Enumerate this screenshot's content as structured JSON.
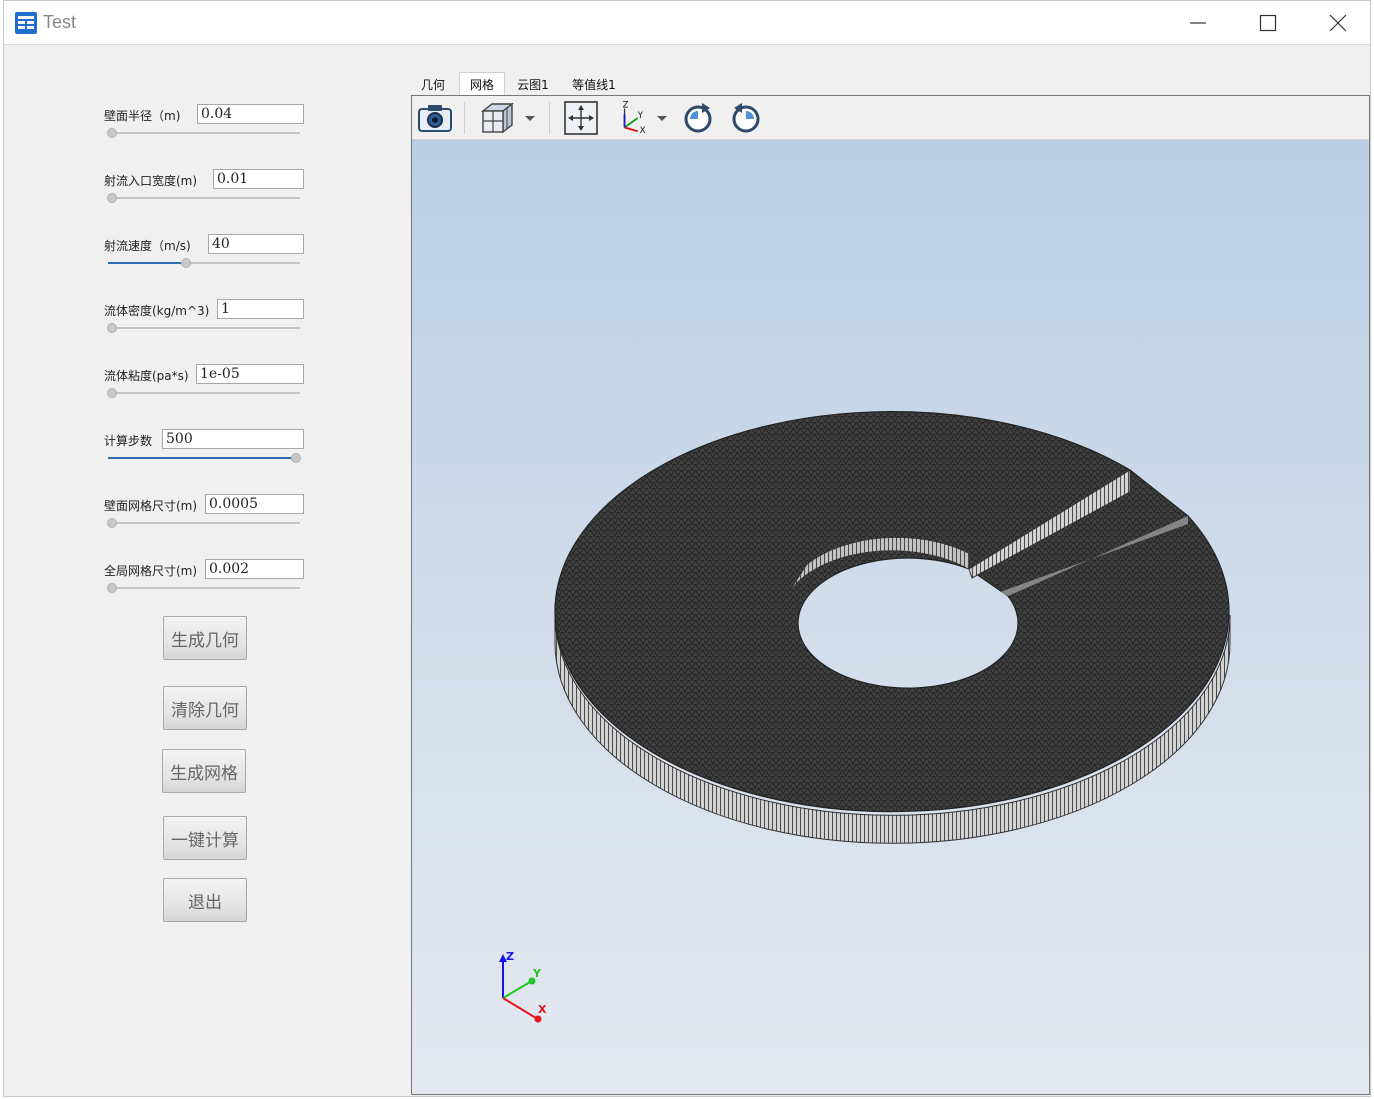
{
  "window": {
    "title": "Test"
  },
  "icons": {
    "app": "app-table-icon",
    "minimize": "minimize-icon",
    "maximize": "maximize-icon",
    "close": "close-icon"
  },
  "params": [
    {
      "label": "壁面半径（m)",
      "value": "0.04",
      "slider_fraction": 0.0
    },
    {
      "label": "射流入口宽度(m)",
      "value": "0.01",
      "slider_fraction": 0.0
    },
    {
      "label": "射流速度（m/s)",
      "value": "40",
      "slider_fraction": 0.4
    },
    {
      "label": "流体密度(kg/m^3)",
      "value": "1",
      "slider_fraction": 0.0
    },
    {
      "label": "流体粘度(pa*s)",
      "value": "1e-05",
      "slider_fraction": 0.0
    },
    {
      "label": "计算步数",
      "value": "500",
      "slider_fraction": 1.0
    },
    {
      "label": "壁面网格尺寸(m)",
      "value": "0.0005",
      "slider_fraction": 0.0
    },
    {
      "label": "全局网格尺寸(m)",
      "value": "0.002",
      "slider_fraction": 0.0
    }
  ],
  "buttons": {
    "generate_geometry": "生成几何",
    "clear_geometry": "清除几何",
    "generate_mesh": "生成网格",
    "compute": "一键计算",
    "exit": "退出"
  },
  "tabs": [
    {
      "label": "几何",
      "active": false
    },
    {
      "label": "网格",
      "active": true
    },
    {
      "label": "云图1",
      "active": false
    },
    {
      "label": "等值线1",
      "active": false
    }
  ],
  "toolbar": {
    "tools": [
      "camera-icon",
      "cube-view-icon",
      "fit-view-icon",
      "axes-orientation-icon",
      "rotate-clockwise-icon",
      "rotate-counterclockwise-icon"
    ]
  },
  "triad": {
    "x": "X",
    "y": "Y",
    "z": "Z"
  },
  "colors": {
    "viewport_top": "#bacfe5",
    "viewport_bottom": "#e4e8ef",
    "mesh_top": "#3a3a3a",
    "mesh_side": "#cfcfcf",
    "axis_x": "#e8141c",
    "axis_y": "#1ec81e",
    "axis_z": "#1414e6",
    "slider_fill": "#2f6fb7"
  }
}
